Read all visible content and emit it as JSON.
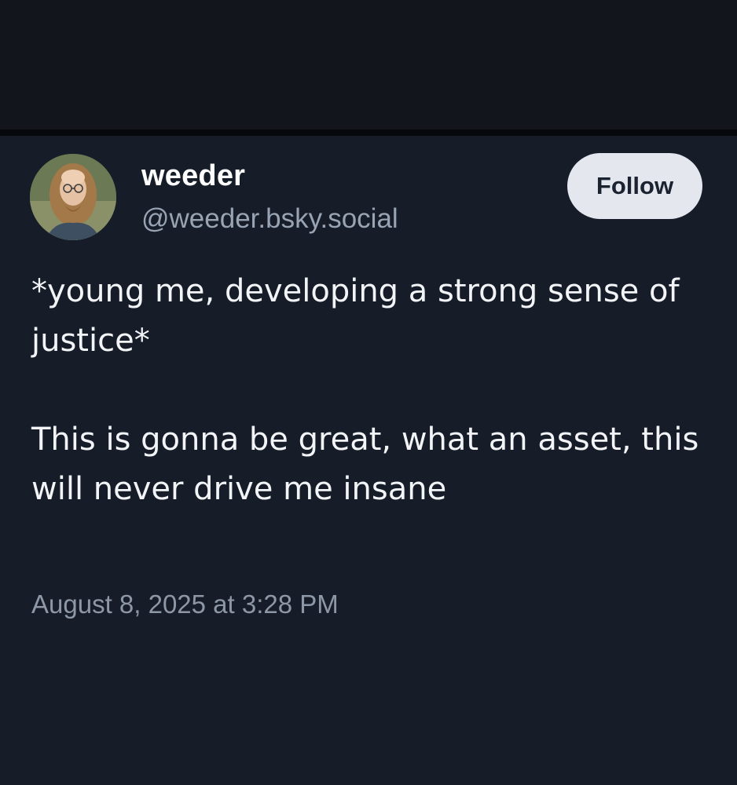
{
  "post": {
    "author": {
      "display_name": "weeder",
      "handle": "@weeder.bsky.social",
      "avatar": "avatar-photo"
    },
    "follow_label": "Follow",
    "paragraphs": [
      "*young me, developing a strong sense of justice*",
      "This is gonna be great, what an asset, this will never drive me insane"
    ],
    "timestamp": "August 8, 2025 at 3:28 PM"
  },
  "colors": {
    "background": "#161d28",
    "top_band": "#12161c",
    "follow_button_bg": "#e4e8ee",
    "handle_text": "#98a3b3",
    "timestamp_text": "#8d97a6"
  }
}
